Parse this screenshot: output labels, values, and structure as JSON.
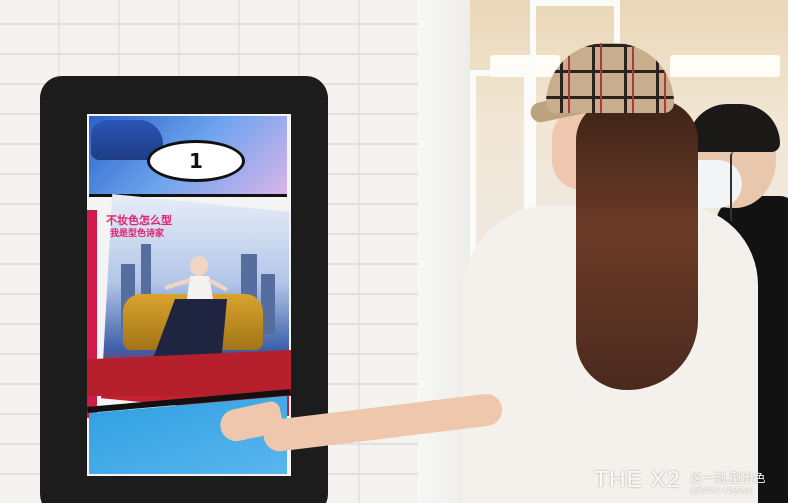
{
  "image": {
    "kind": "photo",
    "description_labels": {
      "screen_panel_number": "1",
      "screen_slogan_line1": "不妆色怎么型",
      "screen_slogan_line2": "我是型色诗家"
    },
    "watermark": {
      "main": "THE X2",
      "tagline": "这一刻,型出色",
      "subline": "创新BMW X2型动派"
    }
  }
}
